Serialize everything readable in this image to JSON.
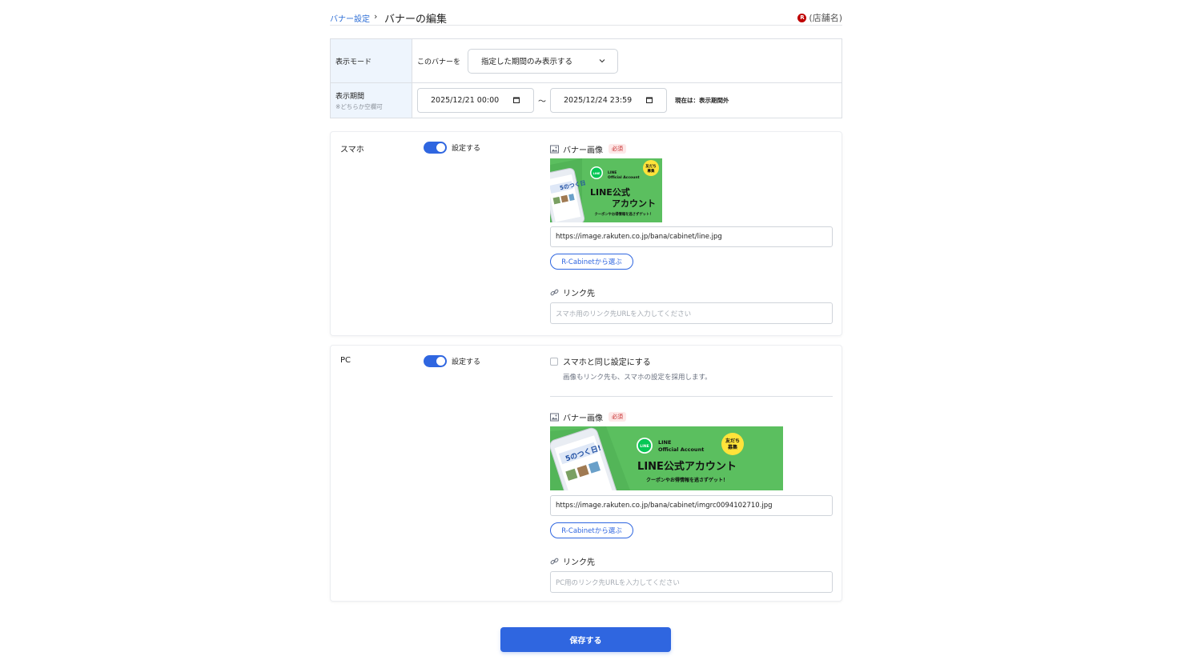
{
  "breadcrumb": {
    "parent": "バナー設定",
    "separator": "›",
    "current": "バナーの編集"
  },
  "shop": {
    "badge": "R",
    "name": "(店舗名)"
  },
  "display_mode": {
    "label": "表示モード",
    "prefix": "このバナーを",
    "selected": "指定した期間のみ表示する"
  },
  "display_period": {
    "label": "表示期間",
    "sublabel": "※どちらか空欄可",
    "start": "2025/12/21 00:00",
    "separator": "〜",
    "end": "2025/12/24 23:59",
    "status": "現在は：表示期間外"
  },
  "sp": {
    "title": "スマホ",
    "toggle_label": "設定する",
    "image_label": "バナー画像",
    "required": "必須",
    "image_url": "https://image.rakuten.co.jp/bana/cabinet/line.jpg",
    "rcabinet_button": "R-Cabinetから選ぶ",
    "link_label": "リンク先",
    "link_placeholder": "スマホ用のリンク先URLを入力してください"
  },
  "pc": {
    "title": "PC",
    "toggle_label": "設定する",
    "same_label": "スマホと同じ設定にする",
    "same_desc": "画像もリンク先も、スマホの設定を採用します。",
    "image_label": "バナー画像",
    "required": "必須",
    "image_url": "https://image.rakuten.co.jp/bana/cabinet/imgrc0094102710.jpg",
    "rcabinet_button": "R-Cabinetから選ぶ",
    "link_label": "リンク先",
    "link_placeholder": "PC用のリンク先URLを入力してください"
  },
  "banner_sp": {
    "line_logo": "LINE",
    "oa_line1": "LINE",
    "oa_line2": "Official Account",
    "main1": "LINE公式",
    "main2": "アカウント",
    "sub": "クーポンやお得情報を逃さずゲット！",
    "badge1": "友だち",
    "badge2": "募集",
    "phone_text": "5のつく日"
  },
  "banner_pc": {
    "line_logo": "LINE",
    "oa_line1": "LINE",
    "oa_line2": "Official Account",
    "main": "LINE公式アカウント",
    "sub": "クーポンやお得情報を逃さずゲット！",
    "badge1": "友だち",
    "badge2": "募集",
    "phone_text": "5のつく日!"
  },
  "save_button": "保存する",
  "colors": {
    "accent": "#2f66e0",
    "link": "#2f6fd6",
    "banner_green": "#5bbf5f",
    "header_bg": "#eef5fd",
    "required_red": "#c62828"
  }
}
